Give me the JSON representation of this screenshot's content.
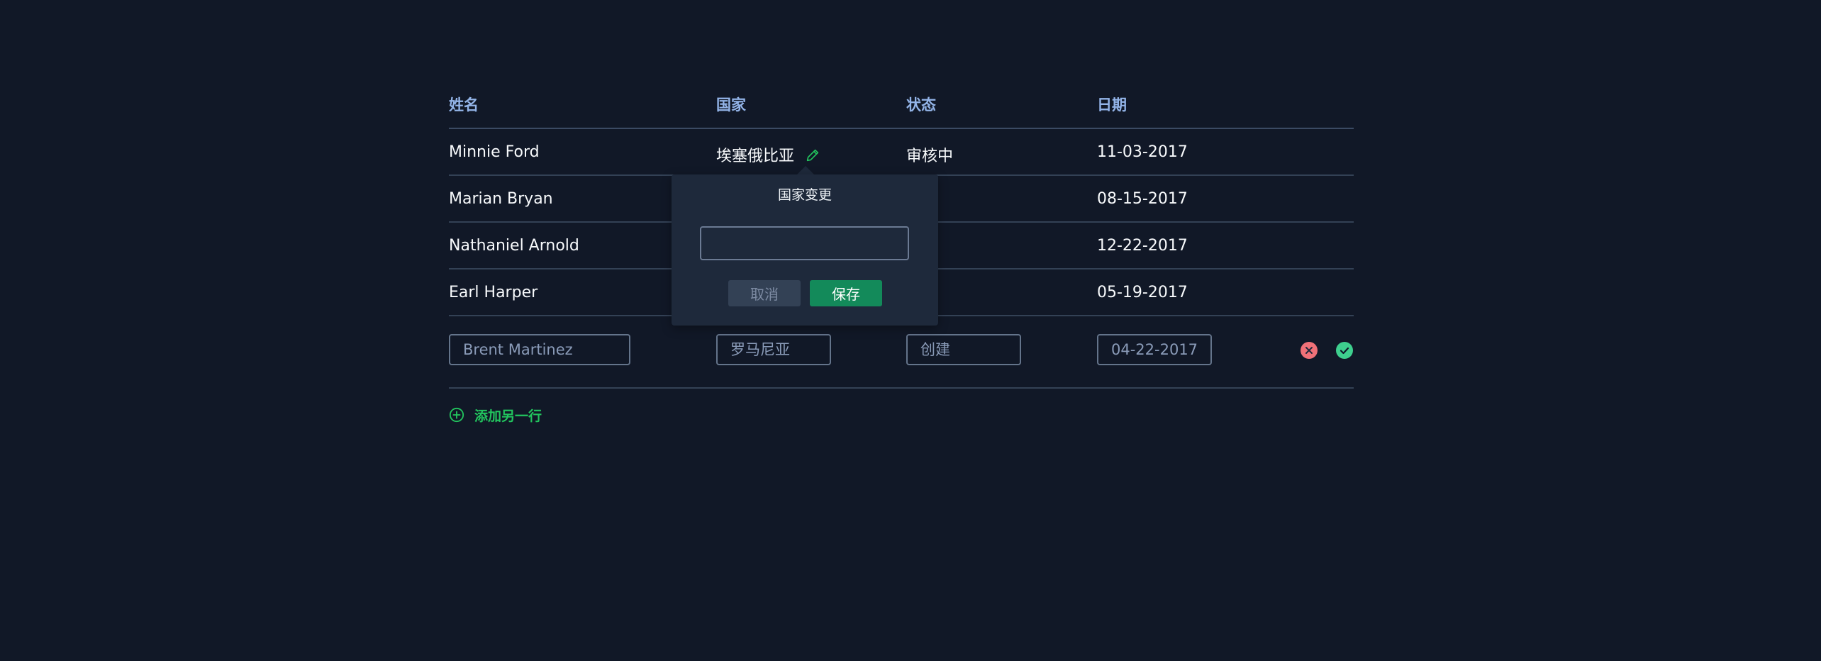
{
  "table": {
    "headers": {
      "name": "姓名",
      "country": "国家",
      "status": "状态",
      "date": "日期"
    },
    "rows": [
      {
        "name": "Minnie Ford",
        "country": "埃塞俄比亚",
        "status": "审核中",
        "date": "11-03-2017",
        "editing": true
      },
      {
        "name": "Marian Bryan",
        "country": "",
        "status": "",
        "date": "08-15-2017"
      },
      {
        "name": "Nathaniel Arnold",
        "country": "",
        "status": "",
        "date": "12-22-2017"
      },
      {
        "name": "Earl Harper",
        "country": "",
        "status": "",
        "date": "05-19-2017"
      }
    ],
    "new_row": {
      "name_placeholder": "Brent Martinez",
      "country_placeholder": "罗马尼亚",
      "status_placeholder": "创建",
      "date_placeholder": "04-22-2017"
    },
    "add_row_label": "添加另一行"
  },
  "popover": {
    "title": "国家变更",
    "input_value": "",
    "cancel_label": "取消",
    "save_label": "保存"
  },
  "colors": {
    "background": "#111827",
    "header_text": "#93b4e8",
    "accent_green": "#22c55e",
    "save_button": "#138a5a",
    "cancel_icon": "#f07178",
    "confirm_icon": "#3ecf8e"
  },
  "icons": {
    "edit": "pencil-icon",
    "cancel": "close-circle-icon",
    "confirm": "check-circle-icon",
    "add": "plus-circle-icon"
  }
}
